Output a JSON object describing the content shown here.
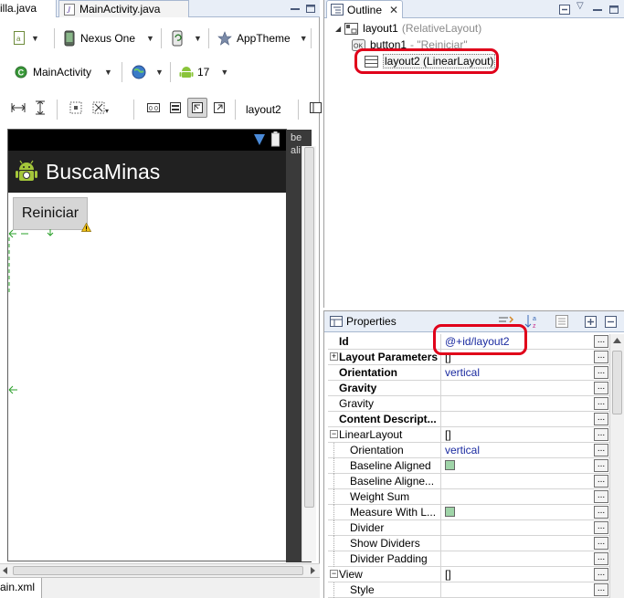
{
  "editor": {
    "tabs": [
      {
        "label": "illa.java"
      },
      {
        "label": "MainActivity.java"
      }
    ],
    "toolbar": {
      "device": "Nexus One",
      "theme": "AppTheme",
      "activity": "MainActivity",
      "api_level": "17",
      "layout_name": "layout2"
    },
    "preview": {
      "app_title": "BuscaMinas",
      "button_label": "Reiniciar",
      "ghost_text_1": "be",
      "ghost_text_2": "ali"
    },
    "bottom_tab": "ain.xml"
  },
  "outline": {
    "tab_label": "Outline",
    "tree": [
      {
        "name": "layout1",
        "type": "(RelativeLayout)"
      },
      {
        "name": "button1",
        "type": "- \"Reiniciar\""
      },
      {
        "name": "layout2 (LinearLayout)",
        "selected": true
      }
    ]
  },
  "properties": {
    "tab_label": "Properties",
    "rows": [
      {
        "name": "Id",
        "value": "@+id/layout2",
        "bold": true,
        "indent": 0,
        "expander": ""
      },
      {
        "name": "Layout Parameters",
        "value": "[]",
        "bold": true,
        "indent": 0,
        "expander": "+"
      },
      {
        "name": "Orientation",
        "value": "vertical",
        "bold": true,
        "indent": 0,
        "expander": ""
      },
      {
        "name": "Gravity",
        "value": "",
        "bold": true,
        "indent": 0,
        "expander": ""
      },
      {
        "name": "Gravity",
        "value": "",
        "bold": false,
        "indent": 0,
        "expander": ""
      },
      {
        "name": "Content Descript...",
        "value": "",
        "bold": true,
        "indent": 0,
        "expander": ""
      },
      {
        "name": "LinearLayout",
        "value": "[]",
        "bold": false,
        "indent": 0,
        "expander": "-"
      },
      {
        "name": "Orientation",
        "value": "vertical",
        "bold": false,
        "indent": 1,
        "expander": ""
      },
      {
        "name": "Baseline Aligned",
        "value": "",
        "bold": false,
        "indent": 1,
        "expander": "",
        "checkbox": true
      },
      {
        "name": "Baseline Aligne...",
        "value": "",
        "bold": false,
        "indent": 1,
        "expander": ""
      },
      {
        "name": "Weight Sum",
        "value": "",
        "bold": false,
        "indent": 1,
        "expander": ""
      },
      {
        "name": "Measure With L...",
        "value": "",
        "bold": false,
        "indent": 1,
        "expander": "",
        "checkbox": true
      },
      {
        "name": "Divider",
        "value": "",
        "bold": false,
        "indent": 1,
        "expander": ""
      },
      {
        "name": "Show Dividers",
        "value": "",
        "bold": false,
        "indent": 1,
        "expander": ""
      },
      {
        "name": "Divider Padding",
        "value": "",
        "bold": false,
        "indent": 1,
        "expander": ""
      },
      {
        "name": "View",
        "value": "[]",
        "bold": false,
        "indent": 0,
        "expander": "-"
      },
      {
        "name": "Style",
        "value": "",
        "bold": false,
        "indent": 1,
        "expander": ""
      }
    ],
    "ellipsis": "..."
  },
  "colors": {
    "highlight": "#e0001a",
    "value_text": "#1a2aa0"
  }
}
